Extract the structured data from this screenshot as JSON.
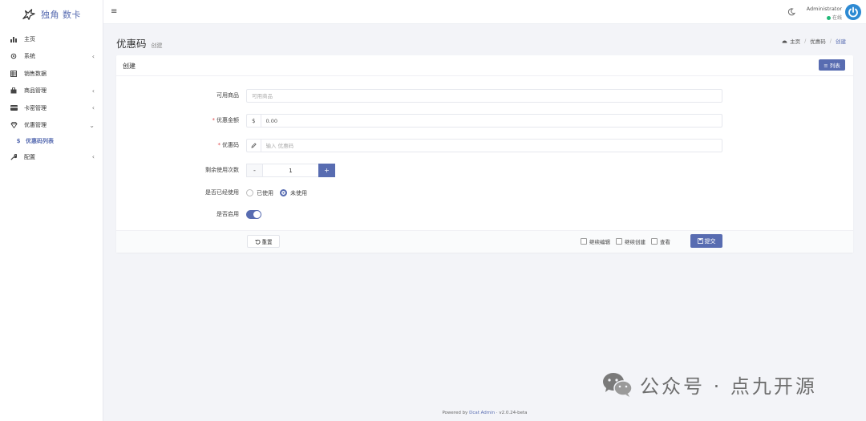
{
  "app": {
    "logo_text": "独角 数卡"
  },
  "sidebar": {
    "items": [
      {
        "label": "主页",
        "icon": "bar-chart-icon",
        "arrow": ""
      },
      {
        "label": "系统",
        "icon": "gear-icon",
        "arrow": "‹"
      },
      {
        "label": "销售数据",
        "icon": "table-icon",
        "arrow": ""
      },
      {
        "label": "商品管理",
        "icon": "shopping-bag-icon",
        "arrow": "‹"
      },
      {
        "label": "卡密管理",
        "icon": "credit-card-icon",
        "arrow": "‹"
      },
      {
        "label": "优惠管理",
        "icon": "diamond-icon",
        "arrow": "⌄"
      }
    ],
    "sub_item": {
      "label": "优惠码列表",
      "icon": "dollar-icon"
    },
    "config": {
      "label": "配置",
      "icon": "wrench-icon",
      "arrow": "‹"
    }
  },
  "topbar": {
    "user_name": "Administrator",
    "user_status": "在线"
  },
  "page": {
    "title": "优惠码",
    "subtitle": "创建",
    "breadcrumb": {
      "home": "主页",
      "section": "优惠码",
      "current": "创建"
    }
  },
  "card": {
    "title": "创建",
    "list_button": "≡ 列表"
  },
  "form": {
    "product": {
      "label": "可用商品",
      "placeholder": "可用商品"
    },
    "amount": {
      "label": "优惠金额",
      "addon": "$",
      "value": "0.00"
    },
    "code": {
      "label": "优惠码",
      "placeholder": "输入 优惠码"
    },
    "remaining": {
      "label": "剩余使用次数",
      "minus": "-",
      "value": "1",
      "plus": "+"
    },
    "used": {
      "label": "是否已经使用",
      "option_used": "已使用",
      "option_unused": "未使用",
      "selected": "未使用"
    },
    "enabled": {
      "label": "是否启用",
      "value": true
    }
  },
  "footer_actions": {
    "reset": "重置",
    "continue_edit": "继续编辑",
    "continue_create": "继续创建",
    "view": "查看",
    "submit": "提交"
  },
  "page_footer": {
    "powered_by": "Powered by",
    "link": "Dcat Admin",
    "sep": "·",
    "version": "v2.0.24-beta"
  },
  "watermark": {
    "text": "公众号 · 点九开源"
  },
  "colors": {
    "primary": "#586cb1",
    "online": "#21b978",
    "required": "#e0484c"
  }
}
